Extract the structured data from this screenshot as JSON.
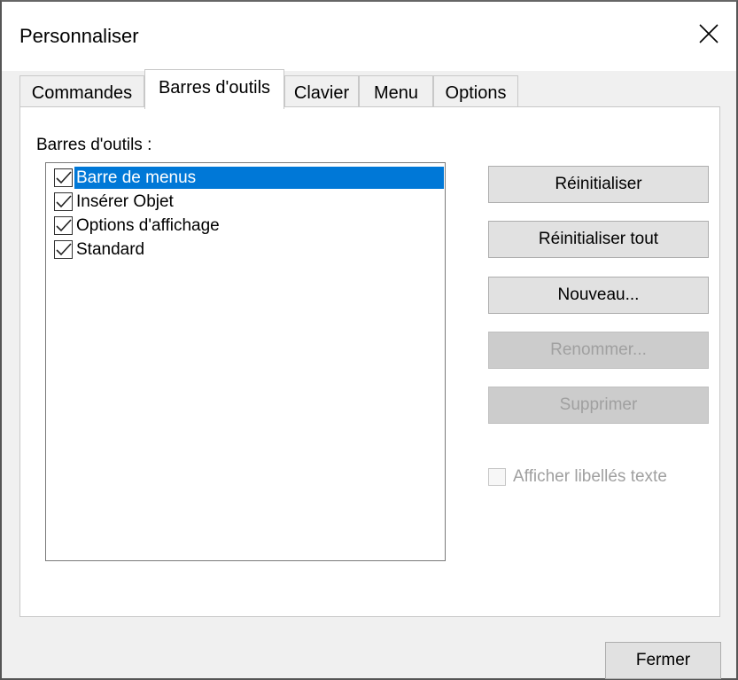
{
  "window": {
    "title": "Personnaliser"
  },
  "tabs": [
    {
      "label": "Commandes",
      "active": false
    },
    {
      "label": "Barres d'outils",
      "active": true
    },
    {
      "label": "Clavier",
      "active": false
    },
    {
      "label": "Menu",
      "active": false
    },
    {
      "label": "Options",
      "active": false
    }
  ],
  "toolbars": {
    "section_label": "Barres d'outils :",
    "items": [
      {
        "label": "Barre de menus",
        "checked": true,
        "selected": true
      },
      {
        "label": "Insérer Objet",
        "checked": true,
        "selected": false
      },
      {
        "label": "Options d'affichage",
        "checked": true,
        "selected": false
      },
      {
        "label": "Standard",
        "checked": true,
        "selected": false
      }
    ]
  },
  "buttons": {
    "reset": "Réinitialiser",
    "reset_all": "Réinitialiser tout",
    "new": "Nouveau...",
    "rename": "Renommer...",
    "delete": "Supprimer"
  },
  "show_text_labels": {
    "label": "Afficher libellés texte",
    "checked": false,
    "enabled": false
  },
  "footer": {
    "close_label": "Fermer"
  },
  "colors": {
    "selection": "#0078d7",
    "disabled_text": "#a0a0a0"
  }
}
